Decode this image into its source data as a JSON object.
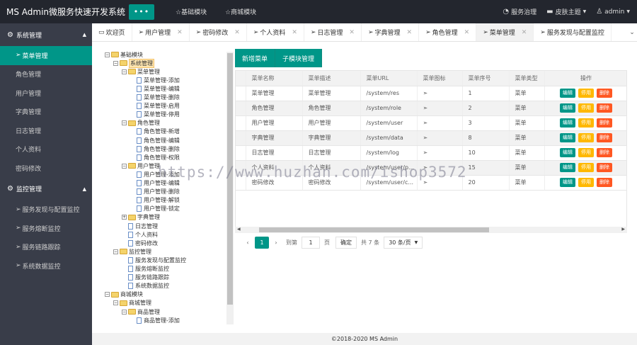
{
  "header": {
    "title": "MS Admin微服务快速开发系统",
    "menu_toggle": "•••",
    "nav": [
      "☆基础模块",
      "☆商城模块"
    ],
    "right": {
      "service": "服务治理",
      "theme": "皮肤主题",
      "user": "admin"
    }
  },
  "sidebar": {
    "groups": [
      {
        "label": "系统管理",
        "items": [
          "菜单管理",
          "角色管理",
          "用户管理",
          "字典管理",
          "日志管理",
          "个人资料",
          "密码修改"
        ]
      },
      {
        "label": "监控管理",
        "items": [
          "服务发现与配置监控",
          "服务熔断监控",
          "服务链路跟踪",
          "系统数据监控"
        ]
      }
    ],
    "active": "菜单管理"
  },
  "tabs": [
    "欢迎页",
    "用户管理",
    "密码修改",
    "个人资料",
    "日志管理",
    "字典管理",
    "角色管理",
    "菜单管理",
    "服务发现与配置监控"
  ],
  "active_tab": "菜单管理",
  "tree": [
    {
      "label": "基础模块",
      "level": 0,
      "type": "folder",
      "toggle": "⊟"
    },
    {
      "label": "系统管理",
      "level": 1,
      "type": "folder",
      "toggle": "⊟",
      "selected": true
    },
    {
      "label": "菜单管理",
      "level": 2,
      "type": "folder",
      "toggle": "⊟"
    },
    {
      "label": "菜单管理-添加",
      "level": 3,
      "type": "doc"
    },
    {
      "label": "菜单管理-编辑",
      "level": 3,
      "type": "doc"
    },
    {
      "label": "菜单管理-删除",
      "level": 3,
      "type": "doc"
    },
    {
      "label": "菜单管理-启用",
      "level": 3,
      "type": "doc"
    },
    {
      "label": "菜单管理-停用",
      "level": 3,
      "type": "doc"
    },
    {
      "label": "角色管理",
      "level": 2,
      "type": "folder",
      "toggle": "⊟"
    },
    {
      "label": "角色管理-新增",
      "level": 3,
      "type": "doc"
    },
    {
      "label": "角色管理-编辑",
      "level": 3,
      "type": "doc"
    },
    {
      "label": "角色管理-删除",
      "level": 3,
      "type": "doc"
    },
    {
      "label": "角色管理-权限",
      "level": 3,
      "type": "doc"
    },
    {
      "label": "用户管理",
      "level": 2,
      "type": "folder",
      "toggle": "⊟"
    },
    {
      "label": "用户管理-添加",
      "level": 3,
      "type": "doc"
    },
    {
      "label": "用户管理-编辑",
      "level": 3,
      "type": "doc"
    },
    {
      "label": "用户管理-删除",
      "level": 3,
      "type": "doc"
    },
    {
      "label": "用户管理-解锁",
      "level": 3,
      "type": "doc"
    },
    {
      "label": "用户管理-锁定",
      "level": 3,
      "type": "doc"
    },
    {
      "label": "字典管理",
      "level": 2,
      "type": "folder",
      "toggle": "⊞"
    },
    {
      "label": "日志管理",
      "level": 2,
      "type": "doc"
    },
    {
      "label": "个人资料",
      "level": 2,
      "type": "doc"
    },
    {
      "label": "密码修改",
      "level": 2,
      "type": "doc"
    },
    {
      "label": "监控管理",
      "level": 1,
      "type": "folder",
      "toggle": "⊟"
    },
    {
      "label": "服务发现与配置监控",
      "level": 2,
      "type": "doc"
    },
    {
      "label": "服务熔断监控",
      "level": 2,
      "type": "doc"
    },
    {
      "label": "服务链路跟踪",
      "level": 2,
      "type": "doc"
    },
    {
      "label": "系统数据监控",
      "level": 2,
      "type": "doc"
    },
    {
      "label": "商城模块",
      "level": 0,
      "type": "folder",
      "toggle": "⊟"
    },
    {
      "label": "商城管理",
      "level": 1,
      "type": "folder",
      "toggle": "⊟"
    },
    {
      "label": "商品管理",
      "level": 2,
      "type": "folder",
      "toggle": "⊟"
    },
    {
      "label": "商品管理-添加",
      "level": 3,
      "type": "doc"
    }
  ],
  "buttons": {
    "add_menu": "新增菜单",
    "child_module": "子模块管理"
  },
  "table": {
    "columns": [
      "菜单名称",
      "菜单描述",
      "菜单URL",
      "菜单图标",
      "菜单序号",
      "菜单类型",
      "操作"
    ],
    "rows": [
      [
        "菜单管理",
        "菜单管理",
        "/system/res",
        "➣",
        "1",
        "菜单"
      ],
      [
        "角色管理",
        "角色管理",
        "/system/role",
        "➣",
        "2",
        "菜单"
      ],
      [
        "用户管理",
        "用户管理",
        "/system/user",
        "➣",
        "3",
        "菜单"
      ],
      [
        "字典管理",
        "字典管理",
        "/system/data",
        "➣",
        "8",
        "菜单"
      ],
      [
        "日志管理",
        "日志管理",
        "/system/log",
        "➣",
        "10",
        "菜单"
      ],
      [
        "个人资料",
        "个人资料",
        "/system/user/p...",
        "➣",
        "15",
        "菜单"
      ],
      [
        "密码修改",
        "密码修改",
        "/system/user/c...",
        "➣",
        "20",
        "菜单"
      ]
    ],
    "ops": {
      "edit": "编辑",
      "disable": "停用",
      "delete": "删除"
    }
  },
  "pager": {
    "current": "1",
    "goto": "到第",
    "page_input": "1",
    "page_unit": "页",
    "confirm": "确定",
    "total": "共 7 条",
    "size": "30 条/页"
  },
  "footer": "©2018-2020 MS Admin",
  "watermark": "https://www.huzhan.com/ishop3572",
  "colors": {
    "accent": "#009688",
    "header_bg": "#23262e",
    "sidebar_bg": "#393d49",
    "warn": "#ffb800",
    "danger": "#ff5722"
  }
}
